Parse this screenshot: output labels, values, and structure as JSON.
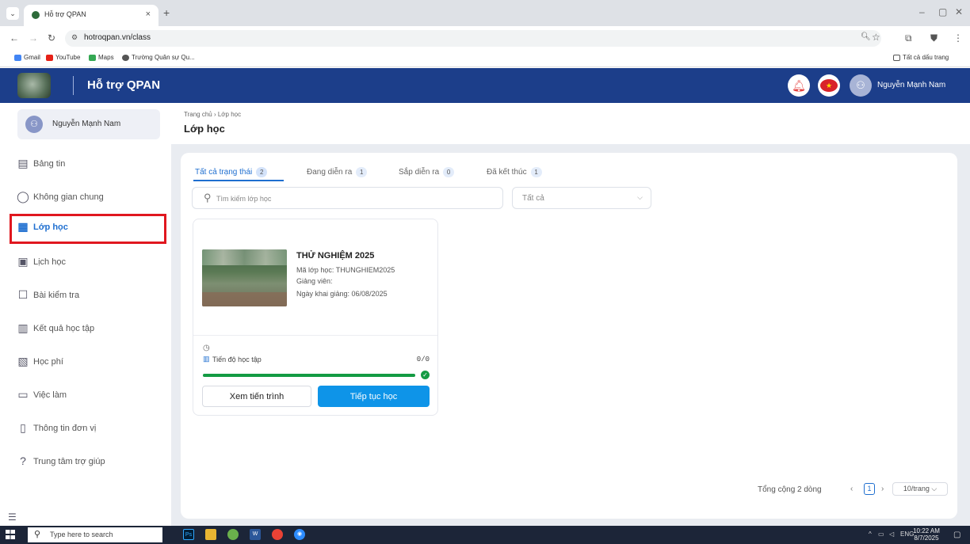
{
  "browser": {
    "tab_title": "Hỗ trợ QPAN",
    "tab_close": "×",
    "new_tab": "+",
    "url": "hotroqpan.vn/class",
    "bookmarks": [
      "Gmail",
      "YouTube",
      "Maps",
      "Trường Quân sự Qu..."
    ],
    "all_bookmarks": "Tất cả dấu trang"
  },
  "header": {
    "brand": "Hỗ trợ QPAN",
    "user_name": "Nguyễn Mạnh Nam"
  },
  "sidebar": {
    "user_name": "Nguyễn Mạnh Nam",
    "items": [
      {
        "label": "Bảng tin",
        "icon": "newsfeed-icon"
      },
      {
        "label": "Không gian chung",
        "icon": "chat-icon"
      },
      {
        "label": "Lớp học",
        "icon": "grid-icon"
      },
      {
        "label": "Lịch học",
        "icon": "calendar-icon"
      },
      {
        "label": "Bài kiểm tra",
        "icon": "test-icon"
      },
      {
        "label": "Kết quả học tập",
        "icon": "report-icon"
      },
      {
        "label": "Học phí",
        "icon": "fee-icon"
      },
      {
        "label": "Việc làm",
        "icon": "briefcase-icon"
      },
      {
        "label": "Thông tin đơn vị",
        "icon": "building-icon"
      },
      {
        "label": "Trung tâm trợ giúp",
        "icon": "help-icon"
      }
    ],
    "active_index": 2
  },
  "page": {
    "breadcrumb": "Trang chủ › Lớp học",
    "title": "Lớp học"
  },
  "status_tabs": [
    {
      "label": "Tất cả trạng thái",
      "count": "2"
    },
    {
      "label": "Đang diễn ra",
      "count": "1"
    },
    {
      "label": "Sắp diễn ra",
      "count": "0"
    },
    {
      "label": "Đã kết thúc",
      "count": "1"
    }
  ],
  "search": {
    "placeholder": "Tìm kiếm lớp học",
    "value": ""
  },
  "filter": {
    "selected": "Tất cả"
  },
  "course": {
    "title": "THỬ NGHIỆM 2025",
    "code_line": "Mã lớp học: THUNGHIEM2025",
    "teacher_line": "Giảng viên:",
    "start_line": "Ngày khai giảng: 06/08/2025",
    "progress_label": "Tiến độ học tập",
    "progress_count": "0/0",
    "progress_fraction": 1.0,
    "view_button": "Xem tiến trình",
    "continue_button": "Tiếp tục học"
  },
  "pagination": {
    "total": "Tổng cộng 2 dòng",
    "current_page": "1",
    "page_size": "10/trang"
  },
  "taskbar": {
    "search_placeholder": "Type here to search",
    "lang": "ENG",
    "time": "10:22 AM",
    "date": "8/7/2025"
  },
  "colors": {
    "header_bg": "#1c3e8a",
    "accent": "#1f6fd0",
    "primary_button": "#0e94e8",
    "progress": "#149b43",
    "highlight_box": "#e0171f"
  }
}
